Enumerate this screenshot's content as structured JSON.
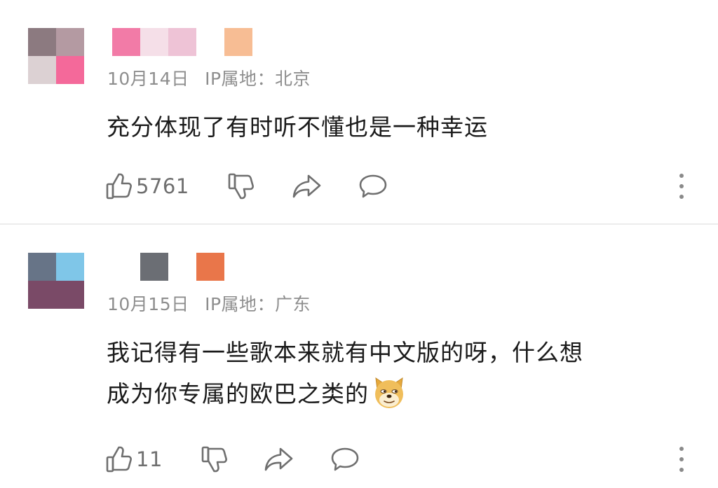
{
  "comments": [
    {
      "avatar_colors": [
        "#8c7a80",
        "#b49aa2",
        "#dcd1d3",
        "#f4699a"
      ],
      "name_colors": [
        "#f27ba7",
        "#f5dfe8",
        "#eec3d6",
        "#ffffff",
        "#f7bd94"
      ],
      "date": "10月14日",
      "ip_label": "IP属地：",
      "location": "北京",
      "text_lines": [
        "充分体现了有时听不懂也是一种幸运"
      ],
      "likes": "5761"
    },
    {
      "avatar_colors": [
        "#677487",
        "#7fc6e8",
        "#7a4a67",
        "#7a4a67"
      ],
      "name_colors": [
        "#ffffff",
        "#6b6e74",
        "#ffffff",
        "#e9764a",
        "#ffffff"
      ],
      "date": "10月15日",
      "ip_label": "IP属地：",
      "location": "广东",
      "text_lines": [
        "我记得有一些歌本来就有中文版的呀，什么想",
        "成为你专属的欧巴之类的"
      ],
      "likes": "11",
      "trailing_emoji": "doge-emoji"
    }
  ],
  "icons": {
    "like": "thumbs-up-icon",
    "dislike": "thumbs-down-icon",
    "share": "share-arrow-icon",
    "reply": "comment-bubble-icon",
    "more": "more-vertical-icon"
  },
  "colors": {
    "text": "#1a1a1a",
    "meta": "#8e8e8e",
    "icon": "#6f6f6f",
    "divider": "#ececec"
  }
}
